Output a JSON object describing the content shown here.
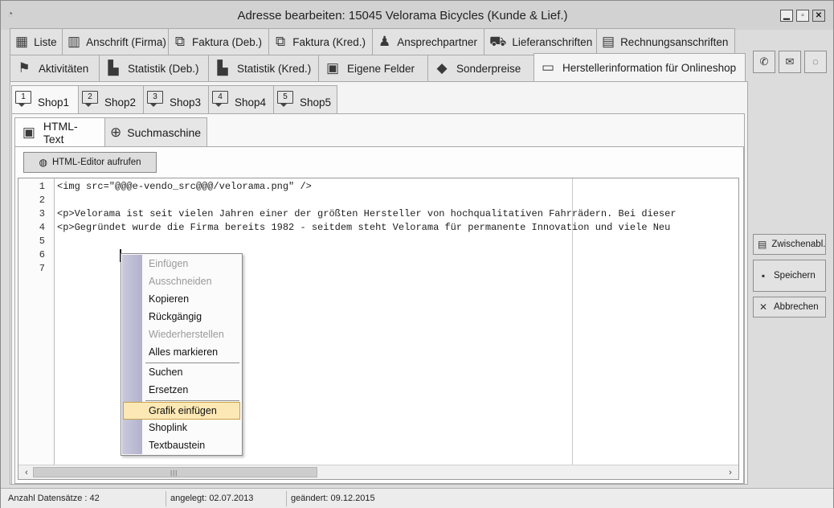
{
  "window": {
    "title": "Adresse bearbeiten: 15045 Velorama Bicycles (Kunde & Lief.)",
    "controls": [
      "minimize-icon",
      "maximize-icon",
      "close-icon"
    ]
  },
  "tabs_row1": [
    {
      "label": "Liste",
      "icon": "table-icon"
    },
    {
      "label": "Anschrift (Firma)",
      "icon": "building-icon"
    },
    {
      "label": "Faktura (Deb.)",
      "icon": "invoice-icon"
    },
    {
      "label": "Faktura (Kred.)",
      "icon": "invoice-icon"
    },
    {
      "label": "Ansprechpartner",
      "icon": "person-icon"
    },
    {
      "label": "Lieferanschriften",
      "icon": "truck-icon"
    },
    {
      "label": "Rechnungsanschriften",
      "icon": "bill-icon"
    }
  ],
  "tabs_row2": [
    {
      "label": "Aktivitäten",
      "icon": "activity-icon"
    },
    {
      "label": "Statistik (Deb.)",
      "icon": "bar-chart-icon"
    },
    {
      "label": "Statistik (Kred.)",
      "icon": "bar-chart-icon"
    },
    {
      "label": "Eigene Felder",
      "icon": "fields-icon"
    },
    {
      "label": "Sonderpreise",
      "icon": "handshake-icon"
    },
    {
      "label": "Herstellerinformation für Onlineshop",
      "icon": "monitor-icon",
      "active": true
    }
  ],
  "shop_tabs": [
    {
      "num": "1",
      "label": "Shop1",
      "active": true
    },
    {
      "num": "2",
      "label": "Shop2"
    },
    {
      "num": "3",
      "label": "Shop3"
    },
    {
      "num": "4",
      "label": "Shop4"
    },
    {
      "num": "5",
      "label": "Shop5"
    }
  ],
  "content_tabs": [
    {
      "label": "HTML-Text",
      "icon": "html-monitor-icon",
      "active": true
    },
    {
      "label": "Suchmaschine",
      "icon": "magnifier-icon"
    }
  ],
  "editor_button": {
    "label": "HTML-Editor aufrufen",
    "icon": "globe-icon"
  },
  "editor": {
    "line_numbers": [
      "1",
      "2",
      "3",
      "4",
      "5",
      "6",
      "7"
    ],
    "lines": [
      "<img src=\"@@@e-vendo_src@@@/velorama.png\" />",
      "",
      "<p>Velorama ist seit vielen Jahren einer der größten Hersteller von hochqualitativen Fahrrädern. Bei dieser",
      "<p>Gegründet wurde die Firma bereits 1982 - seitdem steht Velorama für permanente Innovation und viele Neu",
      "",
      "",
      ""
    ]
  },
  "context_menu": {
    "items": [
      {
        "label": "Einfügen",
        "disabled": true
      },
      {
        "label": "Ausschneiden",
        "disabled": true
      },
      {
        "label": "Kopieren",
        "disabled": false
      },
      {
        "label": "Rückgängig",
        "disabled": false
      },
      {
        "label": "Wiederherstellen",
        "disabled": true
      },
      {
        "label": "Alles markieren",
        "disabled": false
      },
      {
        "label": "Suchen",
        "disabled": false
      },
      {
        "label": "Ersetzen",
        "disabled": false
      },
      {
        "label": "Grafik einfügen",
        "disabled": false,
        "highlighted": true
      },
      {
        "label": "Shoplink",
        "disabled": false
      },
      {
        "label": "Textbaustein",
        "disabled": false
      }
    ]
  },
  "side_icons": [
    "phone-icon",
    "mail-icon",
    "chat-icon"
  ],
  "side_buttons": [
    {
      "label": "Zwischenabl.",
      "icon": "clipboard-icon"
    },
    {
      "label": "Speichern",
      "icon": "save-icon"
    },
    {
      "label": "Abbrechen",
      "icon": "cancel-icon"
    }
  ],
  "status": {
    "records": "Anzahl Datensätze : 42",
    "created": "angelegt: 02.07.2013",
    "changed": "geändert: 09.12.2015"
  }
}
